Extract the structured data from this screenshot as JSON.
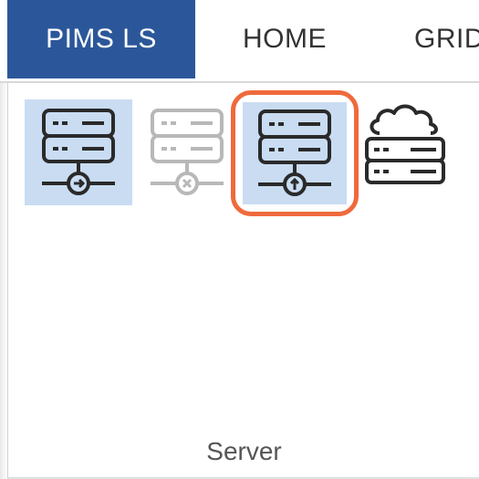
{
  "tabs": [
    {
      "label": "PIMS LS",
      "active": true
    },
    {
      "label": "HOME",
      "active": false
    },
    {
      "label": "GRID",
      "active": false
    }
  ],
  "ribbon": {
    "group_label": "Server",
    "buttons": [
      {
        "icon": "server-connect-icon",
        "state": "selected"
      },
      {
        "icon": "server-disconnect-icon",
        "state": "disabled"
      },
      {
        "icon": "server-upload-icon",
        "state": "highlighted"
      },
      {
        "icon": "cloud-server-icon",
        "state": "normal"
      }
    ]
  },
  "colors": {
    "accent": "#2b579a",
    "selection": "#c9dcf2",
    "highlight_outline": "#ef6a3c"
  }
}
